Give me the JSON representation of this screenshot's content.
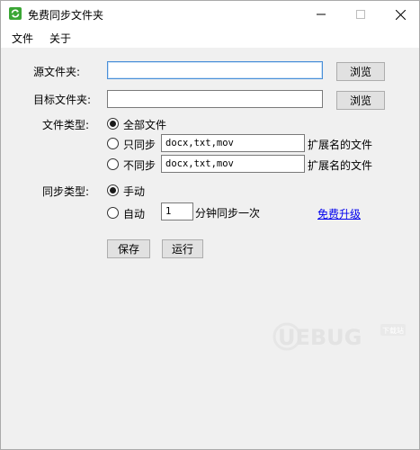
{
  "window": {
    "title": "免费同步文件夹"
  },
  "titlebar": {
    "minimize_glyph": "—",
    "maximize_glyph": "☐",
    "close_glyph": "✕"
  },
  "menu": {
    "file": "文件",
    "about": "关于"
  },
  "source": {
    "label": "源文件夹:",
    "value": "",
    "browse": "浏览"
  },
  "target": {
    "label": "目标文件夹:",
    "value": "",
    "browse": "浏览"
  },
  "filetype": {
    "label": "文件类型:",
    "all": "全部文件",
    "only_sync": "只同步",
    "no_sync": "不同步",
    "only_ext": "docx,txt,mov",
    "no_ext": "docx,txt,mov",
    "suffix": "扩展名的文件",
    "selected": "all"
  },
  "synctype": {
    "label": "同步类型:",
    "manual": "手动",
    "auto": "自动",
    "interval": "1",
    "interval_suffix": "分钟同步一次",
    "selected": "manual"
  },
  "upgrade_link": "免费升级",
  "actions": {
    "save": "保存",
    "run": "运行"
  },
  "watermark": {
    "text": "UEBUG",
    "badge": "下载站"
  },
  "colors": {
    "accent": "#4a8fd8",
    "link": "#0000ee",
    "icon_green": "#3aa635"
  }
}
